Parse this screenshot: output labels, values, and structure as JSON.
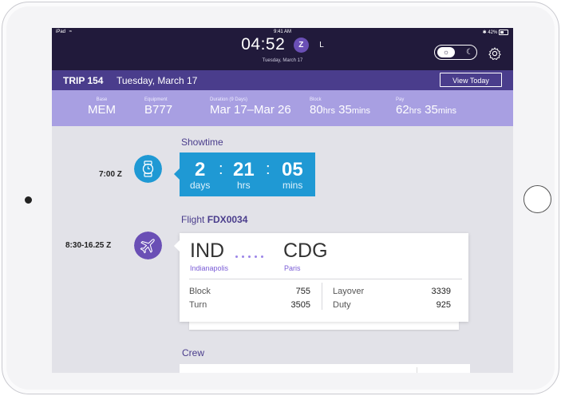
{
  "status_bar": {
    "carrier": "iPad",
    "time": "9:41 AM",
    "battery": "42%"
  },
  "header": {
    "clock": "04:52",
    "zone_badge": "Z",
    "zone_alt": "L",
    "date": "Tuesday, March 17"
  },
  "trip_bar": {
    "trip": "TRIP 154",
    "date": "Tuesday, March 17",
    "view_today_label": "View Today"
  },
  "summary": {
    "base": {
      "label": "Base",
      "value": "MEM"
    },
    "equipment": {
      "label": "Equipment",
      "value": "B777"
    },
    "duration": {
      "label": "Duration (9 Days)",
      "value": "Mar 17–Mar 26"
    },
    "block": {
      "label": "Block",
      "hrs": "80",
      "hrs_unit": "hrs",
      "mins": "35",
      "mins_unit": "mins"
    },
    "pay": {
      "label": "Pay",
      "hrs": "62",
      "hrs_unit": "hrs",
      "mins": "35",
      "mins_unit": "mins"
    }
  },
  "showtime": {
    "title": "Showtime",
    "time": "7:00 Z",
    "days": "2",
    "days_unit": "days",
    "hrs": "21",
    "hrs_unit": "hrs",
    "mins": "05",
    "mins_unit": "mins"
  },
  "flight": {
    "title_prefix": "Flight",
    "flight_number": "FDX0034",
    "time": "8:30-16.25 Z",
    "origin_code": "IND",
    "origin_city": "Indianapolis",
    "dest_code": "CDG",
    "dest_city": "Paris",
    "block_label": "Block",
    "block_value": "755",
    "turn_label": "Turn",
    "turn_value": "3505",
    "layover_label": "Layover",
    "layover_value": "3339",
    "duty_label": "Duty",
    "duty_value": "925"
  },
  "crew": {
    "title": "Crew"
  },
  "colors": {
    "status_bar_bg": "#211a3b",
    "trip_bar_bg": "#4a3d8c",
    "summary_bg": "#a89fe2",
    "showtime_blue": "#1f99d4",
    "accent_purple": "#6a4fb5"
  },
  "icons": {
    "wifi": "wifi-icon",
    "bluetooth": "bluetooth-icon",
    "sun": "sun-icon",
    "moon": "moon-icon",
    "gear": "gear-icon",
    "watch": "watch-icon",
    "plane": "plane-icon"
  }
}
